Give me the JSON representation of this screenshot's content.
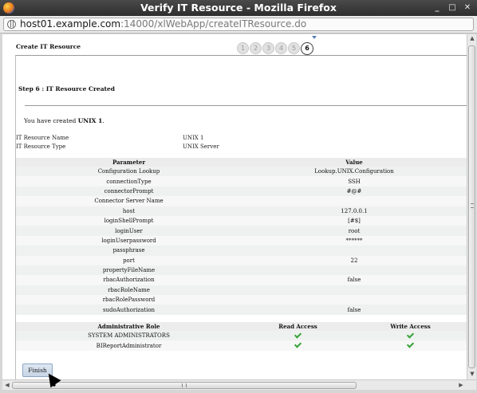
{
  "window": {
    "title": "Verify IT Resource - Mozilla Firefox",
    "btn_min": "_",
    "btn_max": "□",
    "btn_close": "✕"
  },
  "urlbar": {
    "host": "host01.example.com",
    "path": ":14000/xlWebApp/createITResource.do"
  },
  "header": {
    "title": "Create IT Resource",
    "steps": [
      "1",
      "2",
      "3",
      "4",
      "5",
      "6"
    ],
    "active_step": 6
  },
  "step": {
    "title": "Step 6 : IT Resource Created",
    "message_prefix": "You have created ",
    "message_name": "UNIX 1",
    "message_suffix": "."
  },
  "summary": {
    "name_label": "IT Resource Name",
    "name_value": "UNIX 1",
    "type_label": "IT Resource Type",
    "type_value": "UNIX Server"
  },
  "params_table": {
    "headers": [
      "Parameter",
      "Value"
    ],
    "rows": [
      [
        "Configuration Lookup",
        "Lookup.UNIX.Configuration"
      ],
      [
        "connectionType",
        "SSH"
      ],
      [
        "connectorPrompt",
        "#@#"
      ],
      [
        "Connector Server Name",
        ""
      ],
      [
        "host",
        "127.0.0.1"
      ],
      [
        "loginShellPrompt",
        "[#$]"
      ],
      [
        "loginUser",
        "root"
      ],
      [
        "loginUserpassword",
        "******"
      ],
      [
        "passphrase",
        ""
      ],
      [
        "port",
        "22"
      ],
      [
        "propertyFileName",
        ""
      ],
      [
        "rbacAuthorization",
        "false"
      ],
      [
        "rbacRoleName",
        ""
      ],
      [
        "rbacRolePassword",
        ""
      ],
      [
        "sudoAuthorization",
        "false"
      ]
    ]
  },
  "roles_table": {
    "headers": [
      "Administrative Role",
      "Read Access",
      "Write Access"
    ],
    "rows": [
      {
        "role": "SYSTEM ADMINISTRATORS",
        "read": true,
        "write": true
      },
      {
        "role": "BIReportAdministrator",
        "read": true,
        "write": true
      }
    ]
  },
  "actions": {
    "finish_label": "Finish"
  },
  "scrollbar": {
    "up": "▲",
    "down": "▼",
    "left": "◀",
    "right": "▶"
  }
}
